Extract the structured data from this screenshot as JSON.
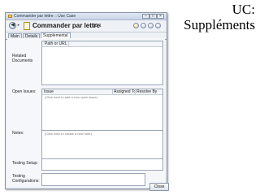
{
  "slide": {
    "title_line1": "UC:",
    "title_line2": "Suppléments"
  },
  "window": {
    "title": "Commander par lettre :: Use Case",
    "controls": [
      "–",
      "□",
      "×"
    ],
    "toolbar": {
      "back_icon": "back-arrow-icon",
      "back_symbol": "◀",
      "forward_symbol": "▸",
      "doc_title": "Commander par lettre",
      "uc_id": "UC-1"
    },
    "tabs": [
      "Main",
      "Details",
      "Supplemental"
    ],
    "active_tab": "Supplemental"
  },
  "form": {
    "related_documents": {
      "label_line1": "Related",
      "label_line2": "Documents",
      "column": "Path or URL"
    },
    "open_issues": {
      "label": "Open Issues:",
      "columns": [
        "Issue",
        "Assigned To",
        "Resolve By"
      ],
      "placeholder": "(Click here to add a new open issue)"
    },
    "notes": {
      "label": "Notes:",
      "placeholder": "(Click here to create a new note)"
    },
    "testing_setup": {
      "label": "Testing Setup:"
    },
    "testing_configurations": {
      "label_line1": "Testing",
      "label_line2": "Configurations:"
    },
    "close_label": "Close"
  }
}
